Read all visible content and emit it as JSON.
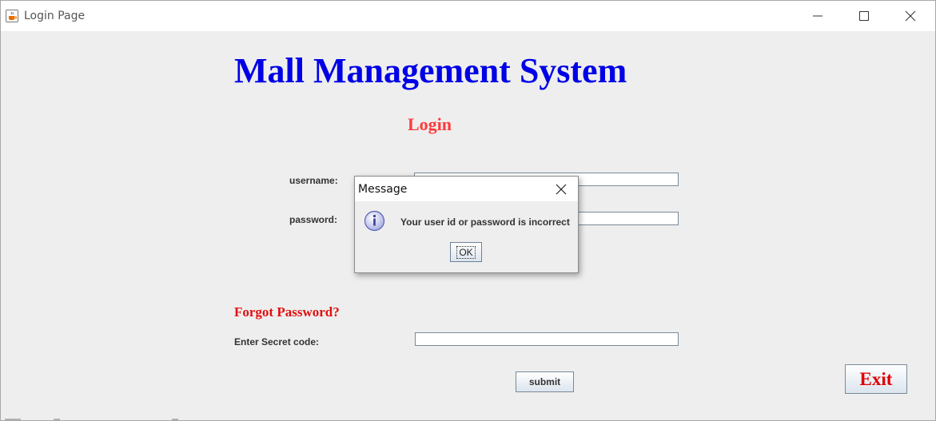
{
  "window": {
    "title": "Login Page",
    "icon": "java-cup-icon",
    "controls": [
      "minimize-icon",
      "maximize-icon",
      "close-icon"
    ]
  },
  "main": {
    "heading": "Mall Management System",
    "login_heading": "Login",
    "username_label": "username:",
    "username_value": "",
    "password_label": "password:",
    "password_value": "",
    "forgot_heading": "Forgot Password?",
    "secret_label": "Enter Secret code:",
    "secret_value": "",
    "submit_label": "submit",
    "exit_label": "Exit"
  },
  "dialog": {
    "title": "Message",
    "icon": "info-icon",
    "message": "Your user id or password is incorrect",
    "ok_label": "OK"
  },
  "colors": {
    "heading": "#0000e6",
    "login_heading": "#ff3b3b",
    "forgot_heading": "#e01010",
    "exit_text": "#e00000",
    "background": "#eeeeee"
  }
}
